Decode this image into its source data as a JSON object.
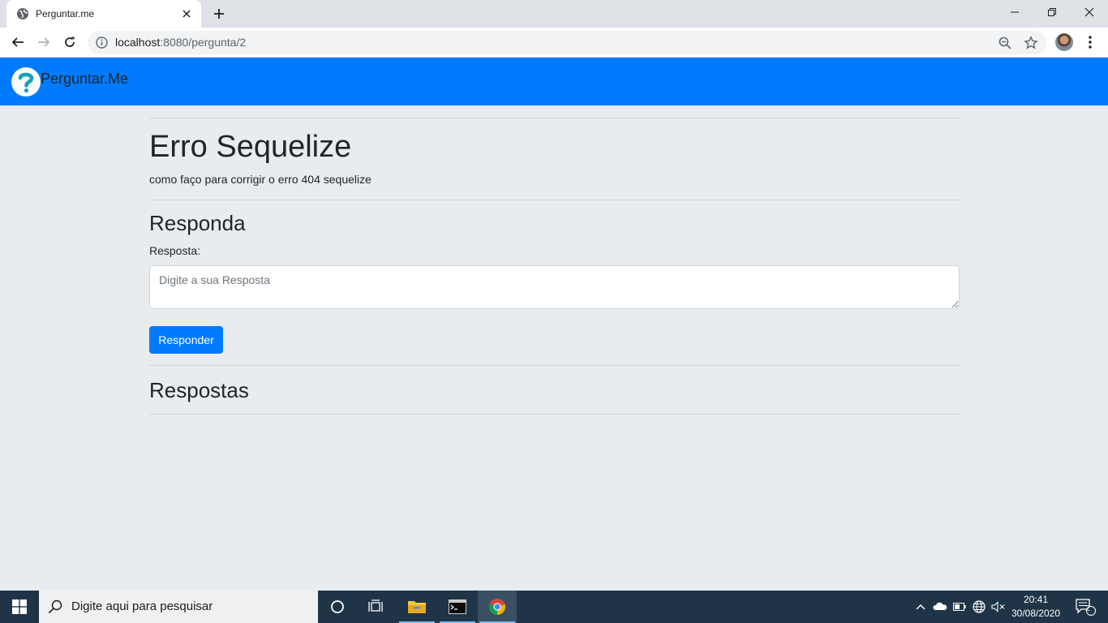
{
  "browser": {
    "tab_title": "Perguntar.me",
    "url_host": "localhost",
    "url_rest": ":8080/pergunta/2"
  },
  "site": {
    "brand": "Perguntar.Me",
    "accent_color": "#007bff"
  },
  "question": {
    "title": "Erro Sequelize",
    "description": "como faço para corrigir o erro 404 sequelize"
  },
  "answer_form": {
    "heading": "Responda",
    "label": "Resposta:",
    "placeholder": "Digite a sua Resposta",
    "submit_label": "Responder"
  },
  "answers": {
    "heading": "Respostas",
    "items": []
  },
  "taskbar": {
    "search_placeholder": "Digite aqui para pesquisar",
    "time": "20:41",
    "date": "30/08/2020",
    "notification_count": "2"
  }
}
